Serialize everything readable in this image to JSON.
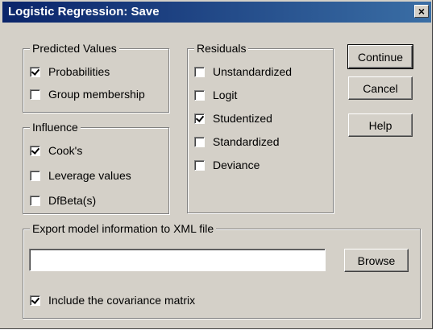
{
  "window": {
    "title": "Logistic Regression: Save",
    "close_glyph": "✕"
  },
  "predicted_values": {
    "legend": "Predicted Values",
    "items": [
      {
        "label": "Probabilities",
        "checked": true
      },
      {
        "label": "Group membership",
        "checked": false
      }
    ]
  },
  "influence": {
    "legend": "Influence",
    "items": [
      {
        "label": "Cook's",
        "checked": true
      },
      {
        "label": "Leverage values",
        "checked": false
      },
      {
        "label": "DfBeta(s)",
        "checked": false
      }
    ]
  },
  "residuals": {
    "legend": "Residuals",
    "items": [
      {
        "label": "Unstandardized",
        "checked": false
      },
      {
        "label": "Logit",
        "checked": false
      },
      {
        "label": "Studentized",
        "checked": true
      },
      {
        "label": "Standardized",
        "checked": false
      },
      {
        "label": "Deviance",
        "checked": false
      }
    ]
  },
  "buttons": {
    "continue": "Continue",
    "cancel": "Cancel",
    "help": "Help",
    "browse": "Browse"
  },
  "export": {
    "legend": "Export model information to XML file",
    "file_value": "",
    "include_covariance": {
      "label": "Include the covariance matrix",
      "checked": true
    }
  }
}
